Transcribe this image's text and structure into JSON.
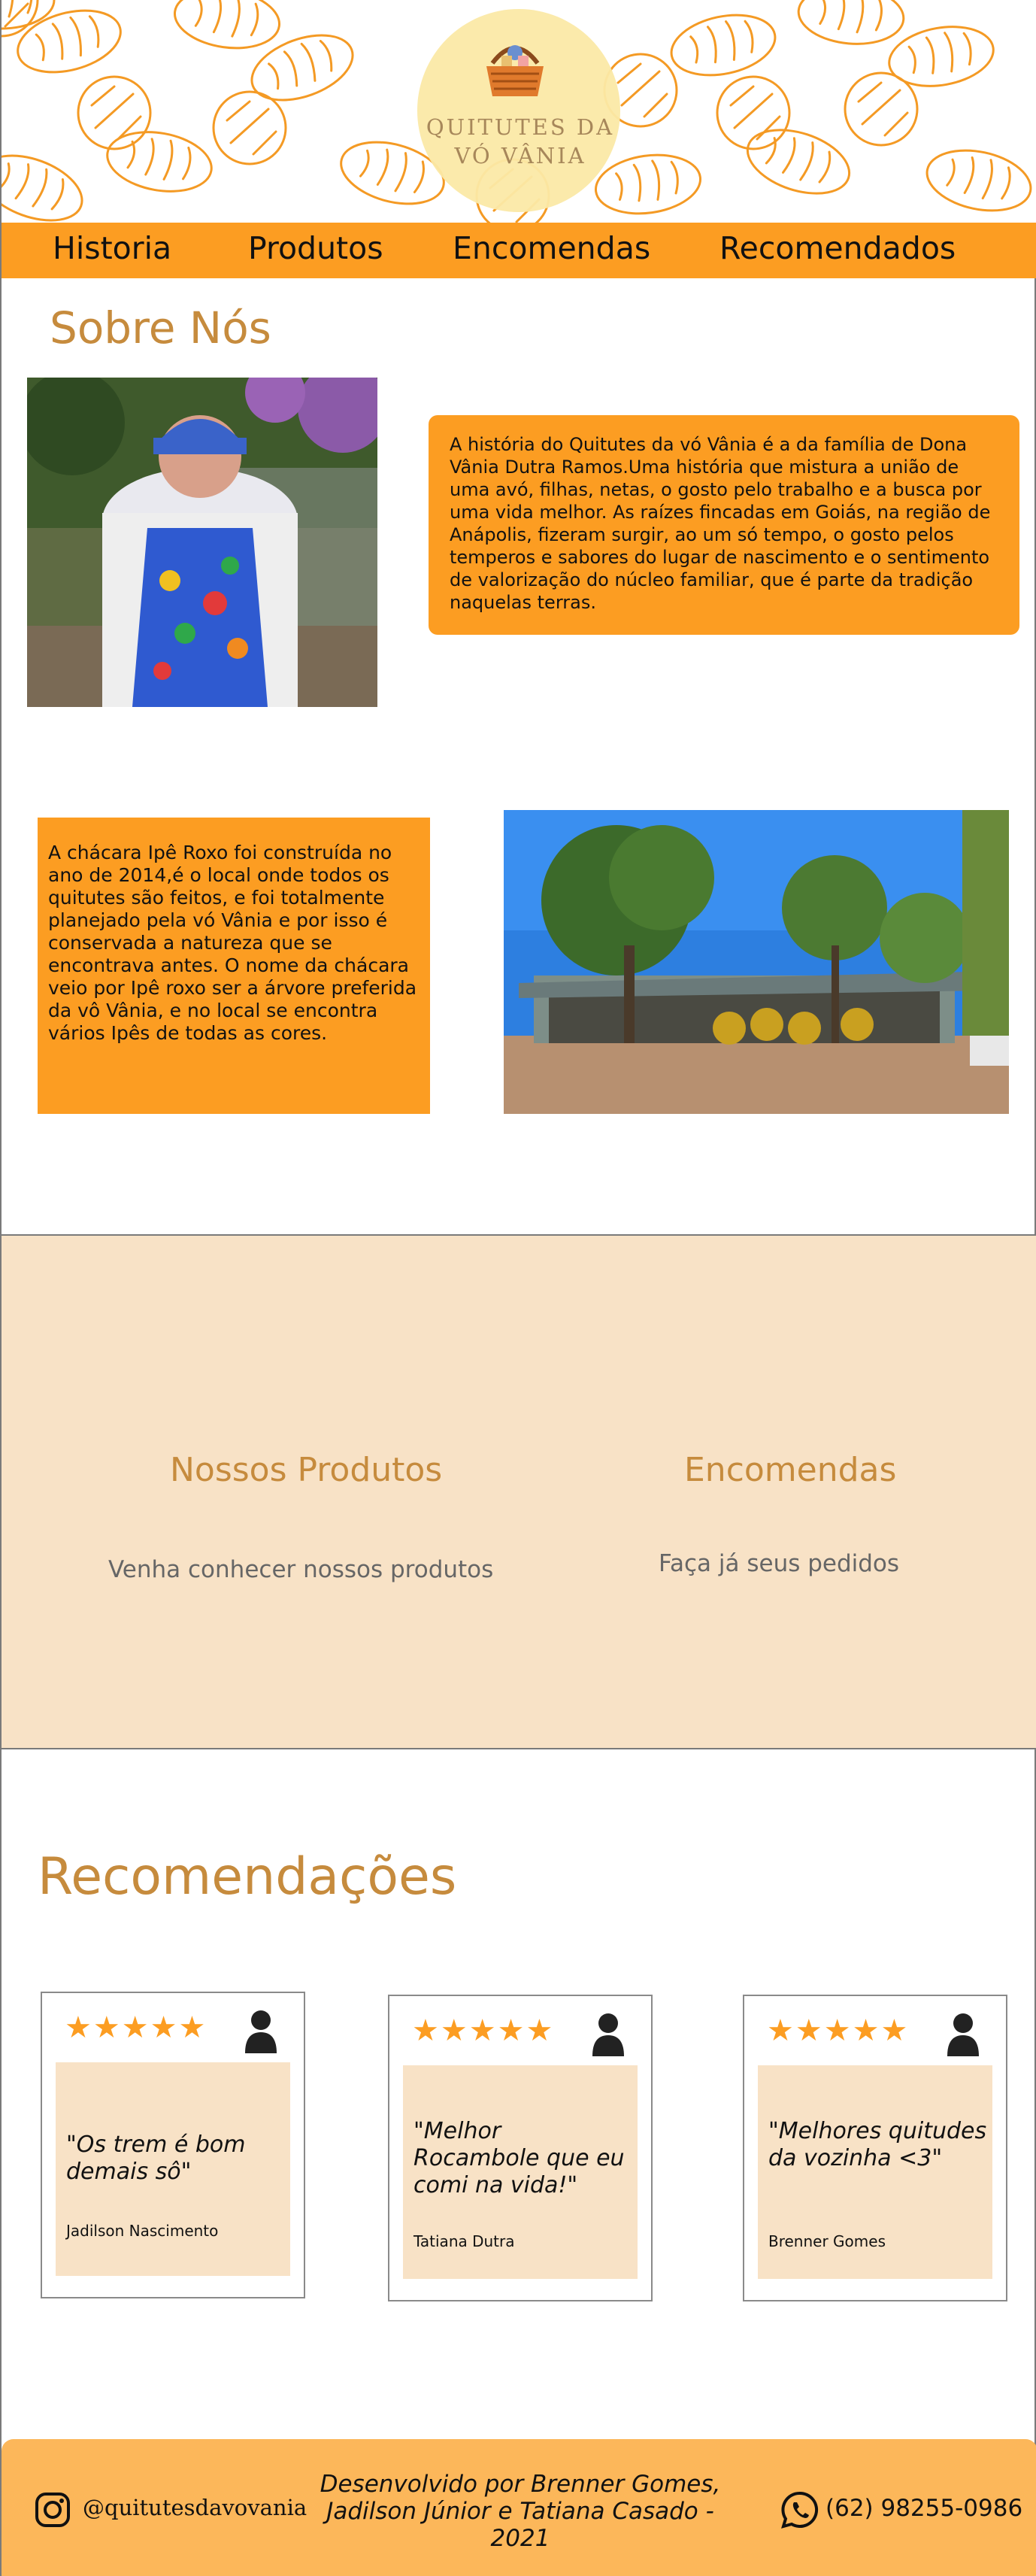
{
  "header": {
    "brand_line1": "QUITUTES DA",
    "brand_line2": "VÓ VÂNIA",
    "pattern_color": "#f49a24",
    "icon": "basket-logo-icon"
  },
  "nav": {
    "items": [
      "Historia",
      "Produtos",
      "Encomendas",
      "Recomendados"
    ],
    "color": "#fc9d22"
  },
  "about": {
    "title": "Sobre Nós",
    "text1": "A história do Quitutes da vó Vânia é a da família de Dona Vânia Dutra Ramos.Uma história que mistura a união de uma avó, filhas, netas, o gosto pelo trabalho e a busca por uma vida melhor. As raízes fincadas em Goiás, na região de Anápolis, fizeram surgir, ao um só tempo, o gosto pelos temperos e sabores do lugar de nascimento e o sentimento de valorização do núcleo familiar, que é parte da tradição naquelas terras.",
    "text2": "A chácara Ipê Roxo foi construída no ano de 2014,é o local onde todos os quitutes são feitos, e foi totalmente planejado pela vó Vânia e por isso é conservada a natureza que se encontrava antes. O nome da chácara veio por Ipê roxo ser a árvore preferida da vô Vânia, e no local se encontra vários Ipês de todas as cores."
  },
  "links_band": {
    "products_title": "Nossos Produtos",
    "products_sub": "Venha conhecer nossos produtos",
    "orders_title": "Encomendas",
    "orders_sub": "Faça já seus pedidos",
    "color": "#f8e2c6"
  },
  "recommendations": {
    "title": "Recomendações",
    "stars": "★★★★★",
    "cards": [
      {
        "quote": "\"Os trem é bom demais sô\"",
        "author": "Jadilson Nascimento"
      },
      {
        "quote": "\"Melhor Rocambole que eu comi na vida!\"",
        "author": "Tatiana Dutra"
      },
      {
        "quote": "\"Melhores quitudes da vozinha <3\"",
        "author": "Brenner Gomes"
      }
    ]
  },
  "footer": {
    "instagram": "@quitutesdavovania",
    "credits": "Desenvolvido por Brenner Gomes, Jadilson Júnior e Tatiana Casado - 2021",
    "phone": "(62) 98255-0986",
    "color": "#fcb75a"
  }
}
